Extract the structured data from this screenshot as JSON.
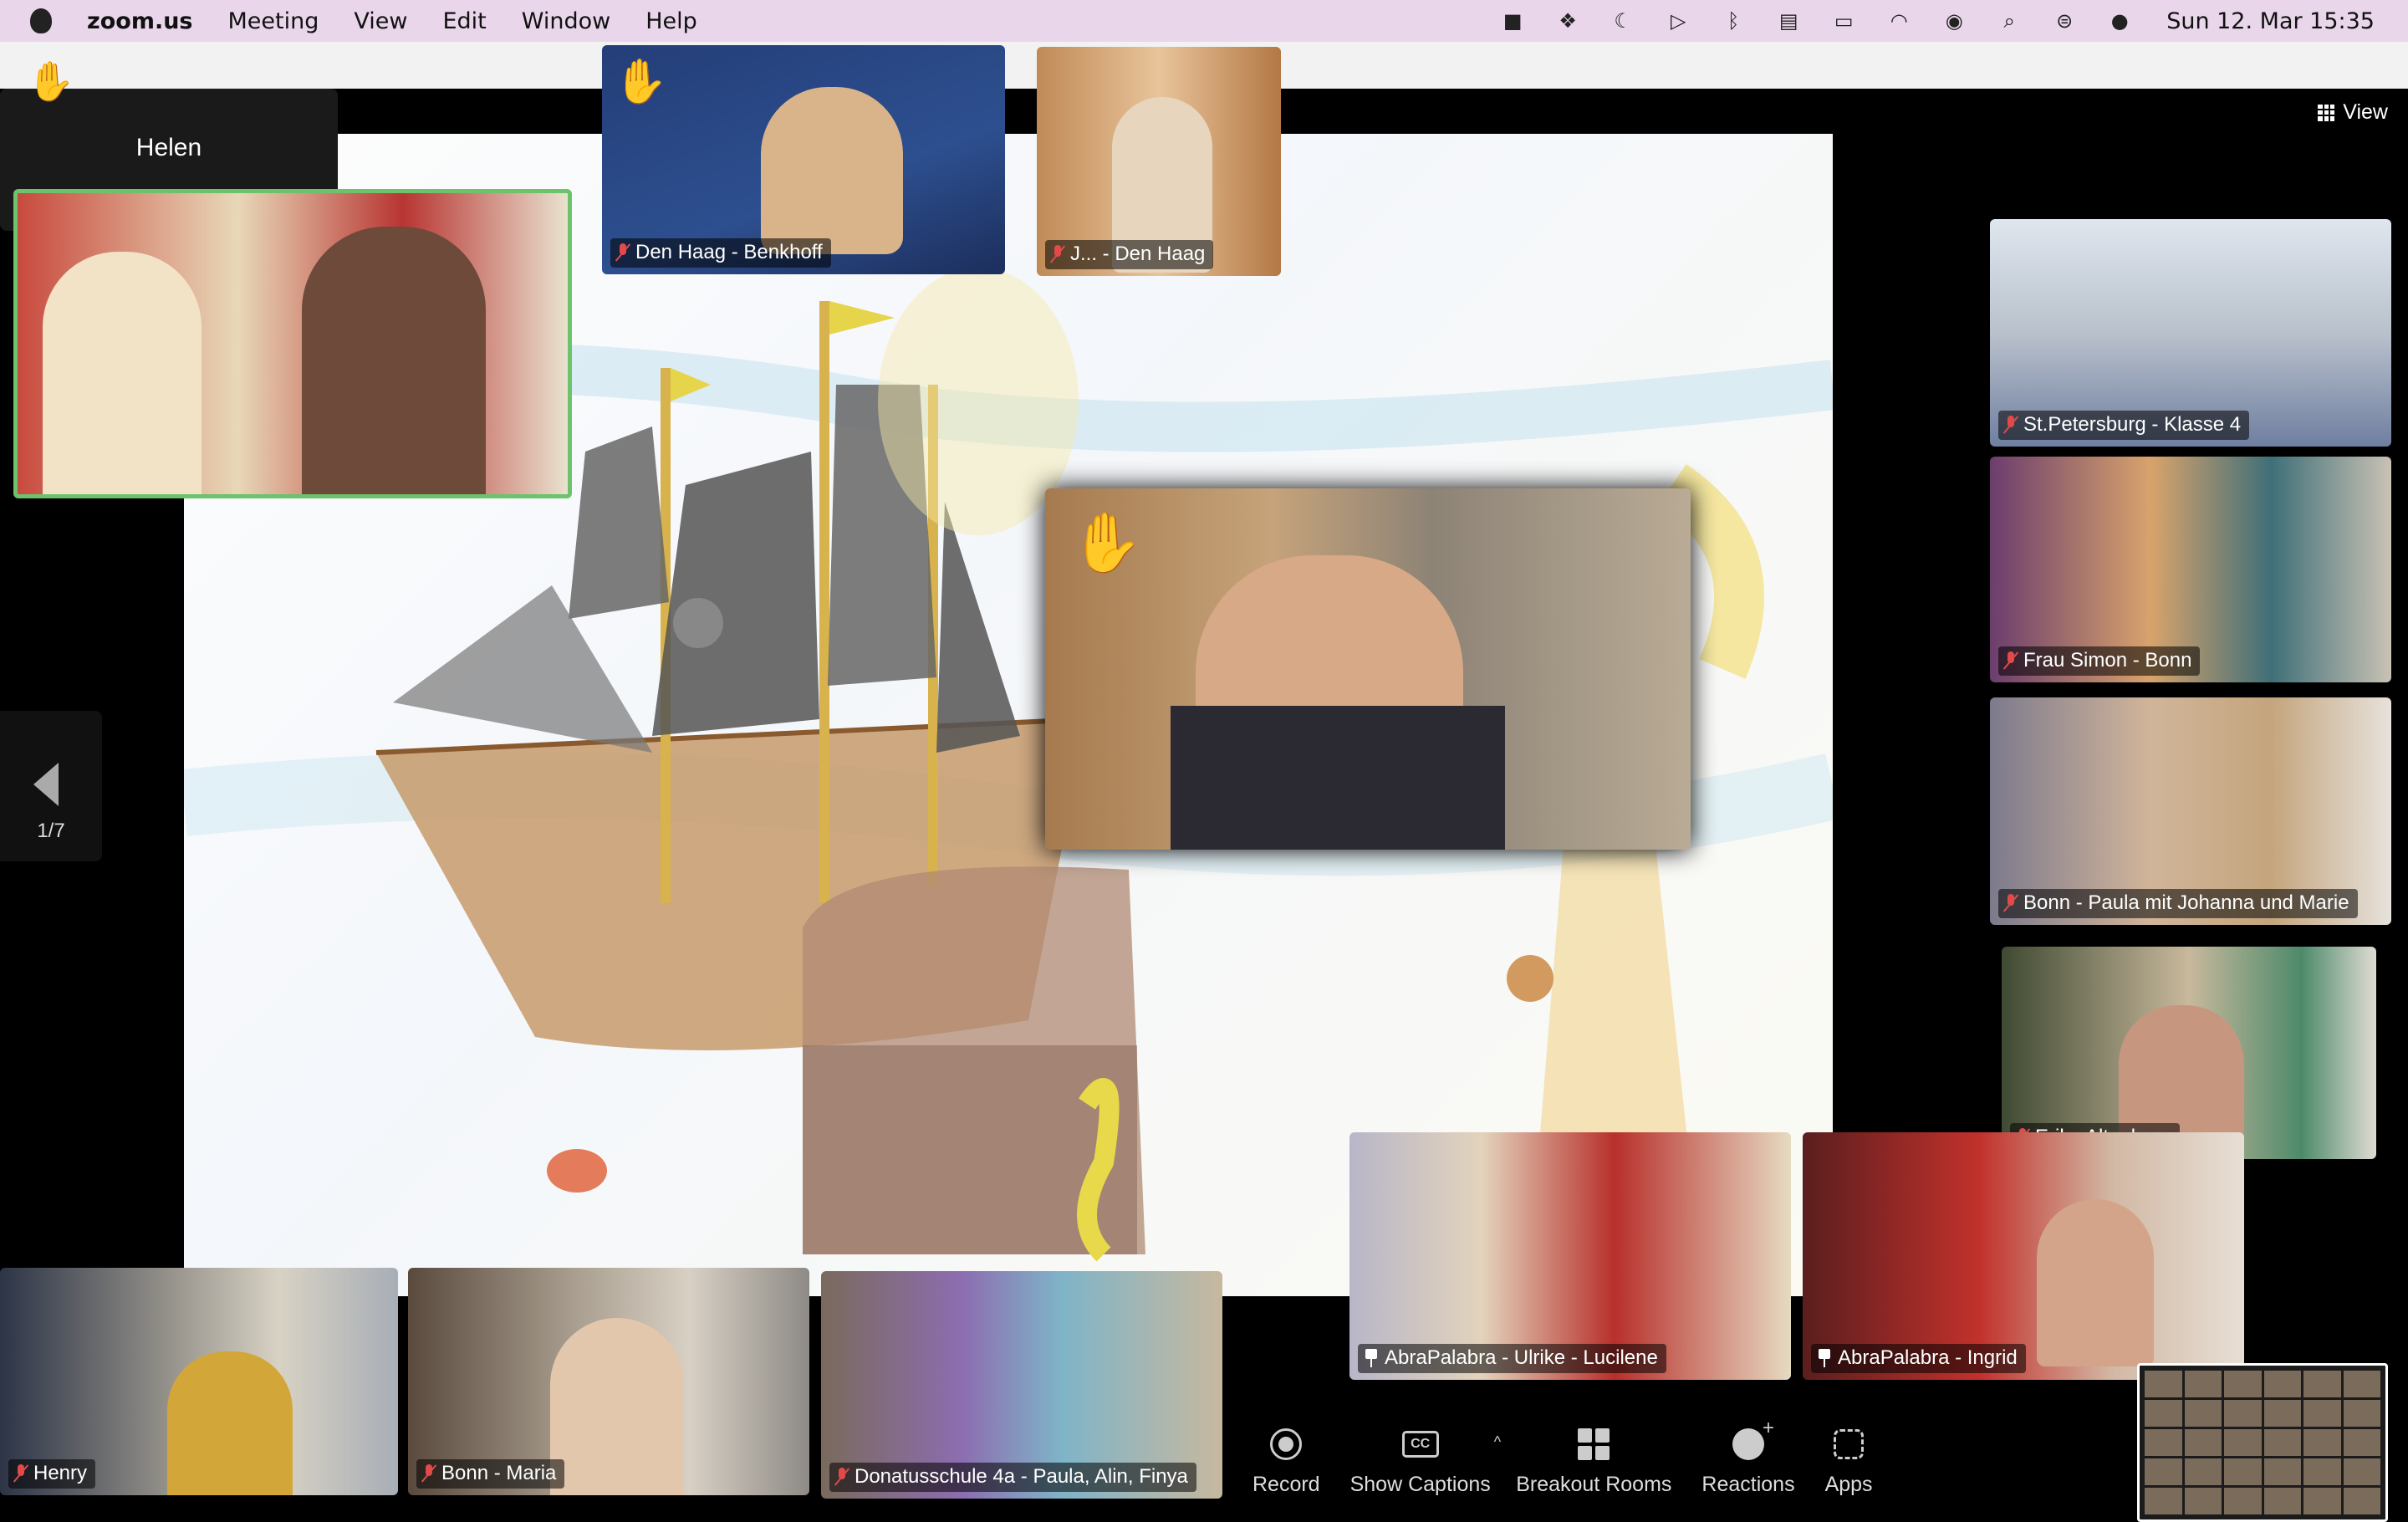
{
  "menubar": {
    "app": "zoom.us",
    "items": [
      "Meeting",
      "View",
      "Edit",
      "Window",
      "Help"
    ],
    "datetime": "Sun 12. Mar  15:35",
    "status_icons": [
      "camera-icon",
      "dropbox-icon",
      "moon-icon",
      "play-icon",
      "bluetooth-icon",
      "calendar-icon",
      "battery-icon",
      "wifi-icon",
      "user-icon",
      "search-icon",
      "control-center-icon",
      "siri-icon"
    ]
  },
  "window": {
    "title": "Zoom Meeting"
  },
  "view_button": {
    "label": "View"
  },
  "raised_hand_panel": {
    "name": "Helen"
  },
  "shared_screen": {
    "page_counter": "1/7"
  },
  "tiles": {
    "den_haag_benkhoff": {
      "label": "Den Haag - Benkhoff"
    },
    "den_haag_child": {
      "label": "J... - Den Haag"
    },
    "st_petersburg": {
      "label": "St.Petersburg - Klasse 4"
    },
    "frau_simon": {
      "label": "Frau Simon - Bonn"
    },
    "bonn_paula": {
      "label": "Bonn - Paula mit Johanna und Marie"
    },
    "erika": {
      "label": "Erika Altenburg"
    },
    "henry": {
      "label": "Henry"
    },
    "bonn_maria": {
      "label": "Bonn - Maria"
    },
    "donatusschule": {
      "label": "Donatusschule 4a - Paula, Alin, Finya"
    },
    "ulrike": {
      "label": "AbraPalabra - Ulrike - Lucilene"
    },
    "ingrid": {
      "label": "AbraPalabra - Ingrid"
    }
  },
  "toolbar": {
    "record": "Record",
    "captions": "Show Captions",
    "breakout": "Breakout Rooms",
    "reactions": "Reactions",
    "apps": "Apps"
  },
  "colors": {
    "menubar_bg": "#e9d6ea",
    "active_speaker_border": "#6cc36b",
    "muted_red": "#e24a4a"
  }
}
